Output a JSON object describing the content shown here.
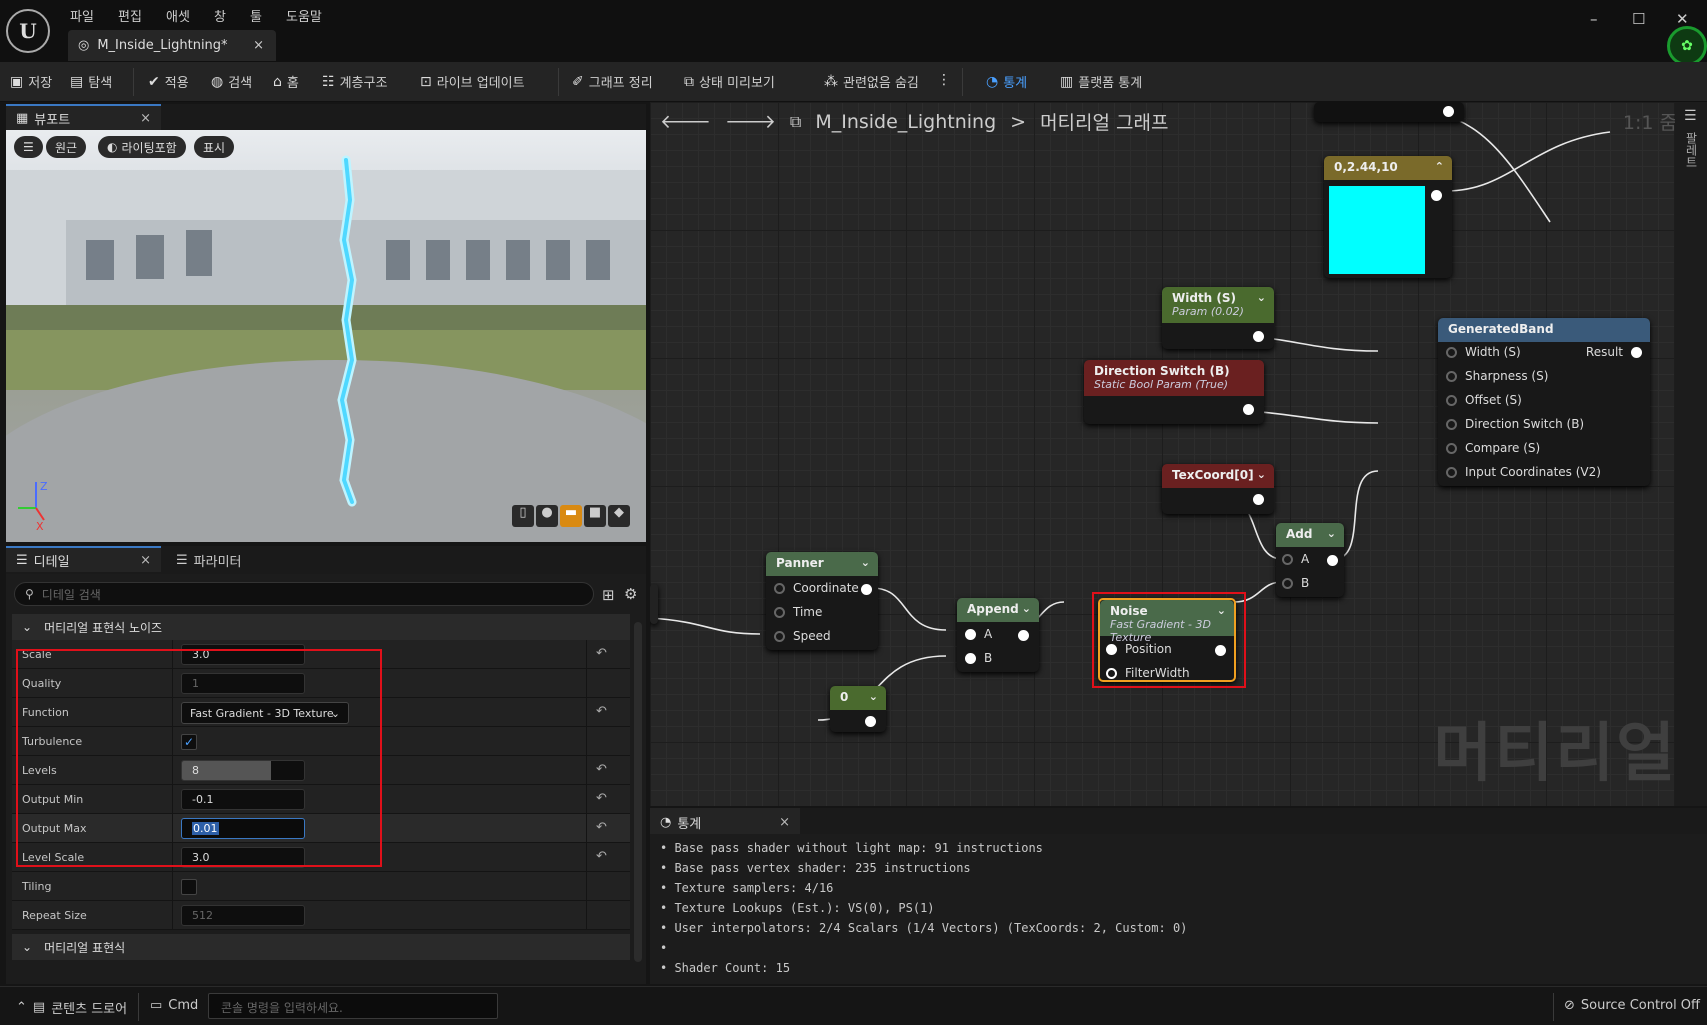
{
  "menu": [
    "파일",
    "편집",
    "애셋",
    "창",
    "툴",
    "도움말"
  ],
  "document_tab": {
    "title": "M_Inside_Lightning*",
    "close": "×"
  },
  "window_controls": {
    "minimize": "–",
    "maximize": "☐",
    "close": "✕"
  },
  "toolbar": {
    "save": "저장",
    "browse": "탐색",
    "apply": "적용",
    "search": "검색",
    "home": "홈",
    "hierarchy": "계층구조",
    "live_update": "라이브 업데이트",
    "clean_graph": "그래프 정리",
    "preview_state": "상태 미리보기",
    "hide_unrelated": "관련없음 숨김",
    "stats": "통계",
    "platform_stats": "플랫폼 통계"
  },
  "viewport": {
    "tab": "뷰포트",
    "close": "×",
    "buttons": {
      "perspective": "원근",
      "lit": "라이팅포함",
      "show": "표시"
    }
  },
  "details": {
    "tabs": [
      {
        "label": "디테일",
        "close": "×"
      },
      {
        "label": "파라미터"
      }
    ],
    "search_placeholder": "디테일 검색",
    "category_noise": "머티리얼 표현식 노이즈",
    "category_expression": "머티리얼 표현식",
    "properties": [
      {
        "label": "Scale",
        "value": "3.0",
        "reset": "↶"
      },
      {
        "label": "Quality",
        "value": "1"
      },
      {
        "label": "Function",
        "value": "Fast Gradient - 3D Texture",
        "reset": "↶"
      },
      {
        "label": "Turbulence",
        "value": "✓"
      },
      {
        "label": "Levels",
        "value": "8",
        "level_fraction": 0.73,
        "reset": "↶"
      },
      {
        "label": "Output Min",
        "value": "-0.1",
        "reset": "↶"
      },
      {
        "label": "Output Max",
        "value": "0.01",
        "reset": "↶"
      },
      {
        "label": "Level Scale",
        "value": "3.0",
        "reset": "↶"
      },
      {
        "label": "Tiling",
        "value": ""
      },
      {
        "label": "Repeat Size",
        "value": "512"
      }
    ]
  },
  "graph": {
    "breadcrumb": {
      "asset": "M_Inside_Lightning",
      "sep": ">",
      "page": "머티리얼 그래프"
    },
    "zoom": "1:1 줌",
    "side_tab": "팔레트",
    "watermark": "머티리얼",
    "nodes": {
      "color": {
        "title": "0,2.44,10",
        "swatch": "#00ffff"
      },
      "width": {
        "title": "Width (S)",
        "sub": "Param (0.02)"
      },
      "dirswitch": {
        "title": "Direction Switch (B)",
        "sub": "Static Bool Param (True)"
      },
      "texcoord": {
        "title": "TexCoord[0]"
      },
      "band": {
        "title": "GeneratedBand",
        "pins": [
          "Width (S)",
          "Sharpness (S)",
          "Offset (S)",
          "Direction Switch (B)",
          "Compare (S)",
          "Input Coordinates (V2)"
        ],
        "out": "Result"
      },
      "panner": {
        "title": "Panner",
        "pins": [
          "Coordinate",
          "Time",
          "Speed"
        ]
      },
      "append": {
        "title": "Append",
        "pins": [
          "A",
          "B"
        ]
      },
      "zero": {
        "title": "0"
      },
      "noise": {
        "title": "Noise",
        "sub": "Fast Gradient - 3D Texture",
        "pins": [
          "Position",
          "FilterWidth"
        ]
      },
      "add": {
        "title": "Add",
        "pins": [
          "A",
          "B"
        ]
      }
    }
  },
  "stats": {
    "tab": "통계",
    "close": "×",
    "lines": [
      "• Base pass shader without light map: 91 instructions",
      "• Base pass vertex shader: 235 instructions",
      "• Texture samplers: 4/16",
      "• Texture Lookups (Est.): VS(0), PS(1)",
      "• User interpolators: 2/4 Scalars (1/4 Vectors) (TexCoords: 2, Custom: 0)",
      "•",
      "• Shader Count: 15"
    ]
  },
  "statusbar": {
    "content_drawer": "콘텐츠 드로어",
    "cmd": "Cmd",
    "cmd_placeholder": "콘솔 명령을 입력하세요.",
    "source_control": "Source Control Off"
  },
  "colors": {
    "accent": "#3a78c3",
    "highlight": "#e0101a",
    "noise_border": "#f0a020"
  }
}
